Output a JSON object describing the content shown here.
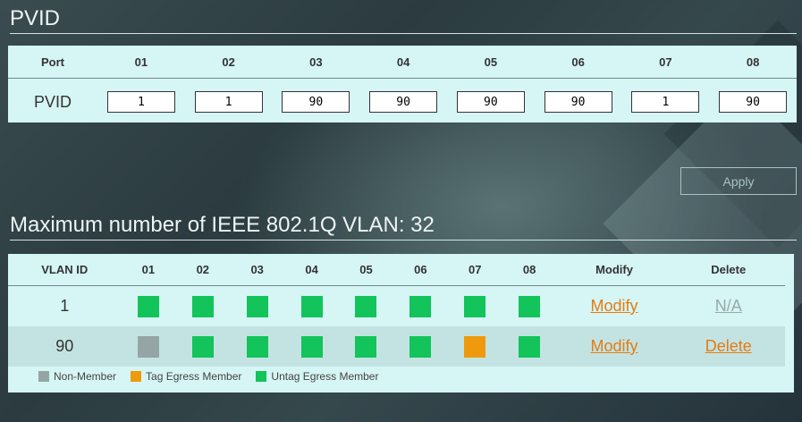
{
  "pvid": {
    "title": "PVID",
    "port_header": "Port",
    "ports": [
      "01",
      "02",
      "03",
      "04",
      "05",
      "06",
      "07",
      "08"
    ],
    "row_label": "PVID",
    "values": [
      "1",
      "1",
      "90",
      "90",
      "90",
      "90",
      "1",
      "90"
    ]
  },
  "apply_label": "Apply",
  "vlan": {
    "title": "Maximum number of IEEE 802.1Q VLAN: 32",
    "headers": {
      "vlan_id": "VLAN ID",
      "ports": [
        "01",
        "02",
        "03",
        "04",
        "05",
        "06",
        "07",
        "08"
      ],
      "modify": "Modify",
      "delete": "Delete"
    },
    "rows": [
      {
        "vlan_id": "1",
        "membership": [
          "untag",
          "untag",
          "untag",
          "untag",
          "untag",
          "untag",
          "untag",
          "untag"
        ],
        "modify_label": "Modify",
        "delete_label": "N/A",
        "delete_enabled": false
      },
      {
        "vlan_id": "90",
        "membership": [
          "non",
          "untag",
          "untag",
          "untag",
          "untag",
          "untag",
          "tag",
          "untag"
        ],
        "modify_label": "Modify",
        "delete_label": "Delete",
        "delete_enabled": true
      }
    ],
    "legend": [
      {
        "key": "non",
        "label": "Non-Member",
        "color": "#95a5a6"
      },
      {
        "key": "tag",
        "label": "Tag Egress Member",
        "color": "#ef9a0c"
      },
      {
        "key": "untag",
        "label": "Untag Egress Member",
        "color": "#12c45a"
      }
    ]
  }
}
